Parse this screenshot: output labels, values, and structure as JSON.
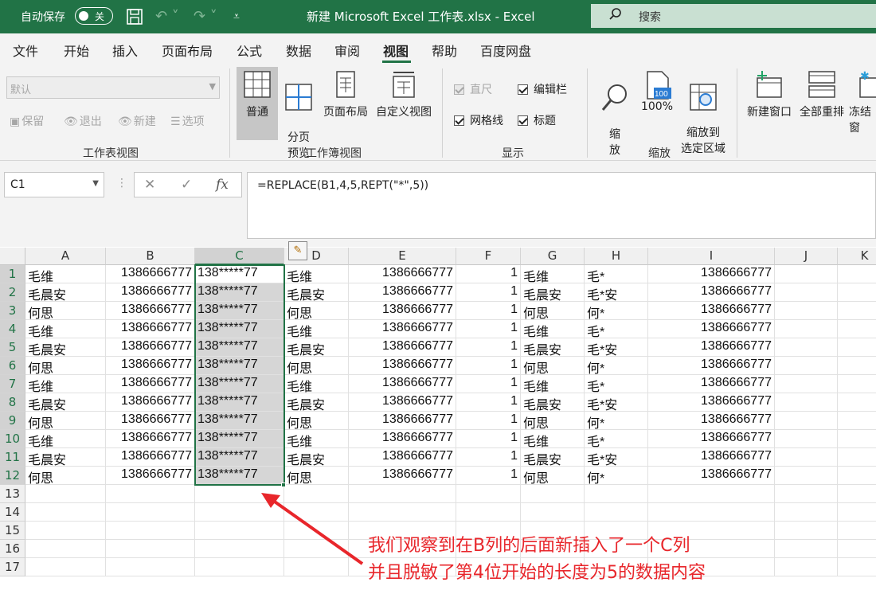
{
  "titlebar": {
    "autosave_label": "自动保存",
    "autosave_state": "关",
    "doc_title": "新建 Microsoft Excel 工作表.xlsx  -  Excel",
    "search_placeholder": "搜索"
  },
  "menu_tabs": [
    "文件",
    "开始",
    "插入",
    "页面布局",
    "公式",
    "数据",
    "审阅",
    "视图",
    "帮助",
    "百度网盘"
  ],
  "active_tab": "视图",
  "ribbon": {
    "sheet_view": {
      "select_value": "默认",
      "buttons": [
        "保留",
        "退出",
        "新建",
        "选项"
      ],
      "group_label": "工作表视图"
    },
    "workbook_views": {
      "buttons": [
        "普通",
        "分页\n预览",
        "页面布局",
        "自定义视图"
      ],
      "group_label": "工作簿视图"
    },
    "show": {
      "checks": [
        {
          "label": "直尺",
          "checked": true,
          "enabled": false
        },
        {
          "label": "编辑栏",
          "checked": true,
          "enabled": true
        },
        {
          "label": "网格线",
          "checked": true,
          "enabled": true
        },
        {
          "label": "标题",
          "checked": true,
          "enabled": true
        }
      ],
      "group_label": "显示"
    },
    "zoom": {
      "buttons": [
        "缩\n放",
        "100%",
        "缩放到\n选定区域"
      ],
      "group_label": "缩放"
    },
    "window": {
      "buttons": [
        "新建窗口",
        "全部重排",
        "冻结窗"
      ]
    }
  },
  "formula_bar": {
    "name_box": "C1",
    "formula": "=REPLACE(B1,4,5,REPT(\"*\",5))"
  },
  "columns": [
    "A",
    "B",
    "C",
    "D",
    "E",
    "F",
    "G",
    "H",
    "I",
    "J",
    "K"
  ],
  "selected_column": "C",
  "rows": [
    [
      "毛维",
      "1386666777",
      "138*****77",
      "毛维",
      "1386666777",
      "1",
      "毛维",
      "毛*",
      "1386666777"
    ],
    [
      "毛晨安",
      "1386666777",
      "138*****77",
      "毛晨安",
      "1386666777",
      "1",
      "毛晨安",
      "毛*安",
      "1386666777"
    ],
    [
      "何思",
      "1386666777",
      "138*****77",
      "何思",
      "1386666777",
      "1",
      "何思",
      "何*",
      "1386666777"
    ],
    [
      "毛维",
      "1386666777",
      "138*****77",
      "毛维",
      "1386666777",
      "1",
      "毛维",
      "毛*",
      "1386666777"
    ],
    [
      "毛晨安",
      "1386666777",
      "138*****77",
      "毛晨安",
      "1386666777",
      "1",
      "毛晨安",
      "毛*安",
      "1386666777"
    ],
    [
      "何思",
      "1386666777",
      "138*****77",
      "何思",
      "1386666777",
      "1",
      "何思",
      "何*",
      "1386666777"
    ],
    [
      "毛维",
      "1386666777",
      "138*****77",
      "毛维",
      "1386666777",
      "1",
      "毛维",
      "毛*",
      "1386666777"
    ],
    [
      "毛晨安",
      "1386666777",
      "138*****77",
      "毛晨安",
      "1386666777",
      "1",
      "毛晨安",
      "毛*安",
      "1386666777"
    ],
    [
      "何思",
      "1386666777",
      "138*****77",
      "何思",
      "1386666777",
      "1",
      "何思",
      "何*",
      "1386666777"
    ],
    [
      "毛维",
      "1386666777",
      "138*****77",
      "毛维",
      "1386666777",
      "1",
      "毛维",
      "毛*",
      "1386666777"
    ],
    [
      "毛晨安",
      "1386666777",
      "138*****77",
      "毛晨安",
      "1386666777",
      "1",
      "毛晨安",
      "毛*安",
      "1386666777"
    ],
    [
      "何思",
      "1386666777",
      "138*****77",
      "何思",
      "1386666777",
      "1",
      "何思",
      "何*",
      "1386666777"
    ]
  ],
  "row_numbers": [
    "1",
    "2",
    "3",
    "4",
    "5",
    "6",
    "7",
    "8",
    "9",
    "10",
    "11",
    "12",
    "13",
    "14",
    "15",
    "16",
    "17"
  ],
  "annotation": {
    "line1": "我们观察到在B列的后面新插入了一个C列",
    "line2": "并且脱敏了第4位开始的长度为5的数据内容",
    "color": "#e8262b"
  },
  "colors": {
    "excel_green": "#217346"
  }
}
